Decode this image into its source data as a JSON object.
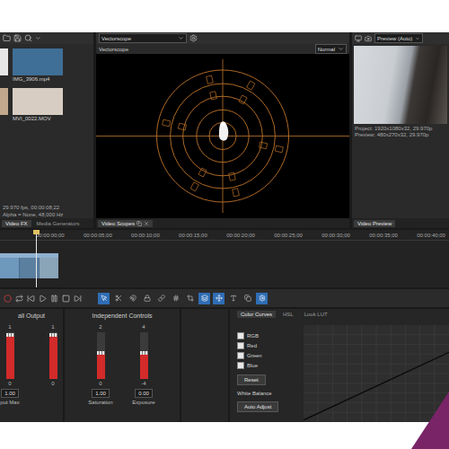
{
  "media": {
    "files": [
      {
        "name": "",
        "color": "#e6e6e6"
      },
      {
        "name": "IMG_3906.mp4",
        "color": "#3f6f97"
      },
      {
        "name": "",
        "color": "#c2a88c"
      },
      {
        "name": "MVI_0022.MOV",
        "color": "#d8cdc2"
      }
    ],
    "info": [
      "29.970 fps, 00:00:08;22",
      "Alpha = None, 48,000 Hz"
    ],
    "tabs": [
      {
        "label": "Video FX",
        "selected": true
      },
      {
        "label": "Media Generators",
        "selected": false
      }
    ]
  },
  "scope": {
    "type": "Vectorscope",
    "title": "Vectorscope",
    "mode": "Normal",
    "tab": "Video Scopes"
  },
  "preview": {
    "quality": "Preview (Auto)",
    "project": "Project: 1920x1080x32, 29.970p",
    "preview": "Preview: 480x270x32, 29.970p",
    "tab": "Video Preview"
  },
  "timeline": {
    "ruler": [
      "00:00:00;00",
      "00:00:05;00",
      "00:00:10;00",
      "00:00:15;00",
      "00:00:20;00",
      "00:00:25;00",
      "00:00:30;00",
      "00:00:35;00",
      "00:00:40;00"
    ],
    "playhead": {
      "level": 0.08
    },
    "clip": {
      "level": 0.13
    }
  },
  "transport": {
    "tools": [
      {
        "selected": true
      },
      {
        "selected": false
      },
      {
        "selected": false
      },
      {
        "selected": false
      },
      {
        "selected": false
      },
      {
        "selected": false
      },
      {
        "selected": false
      },
      {
        "selected": true
      },
      {
        "selected": true
      },
      {
        "selected": false
      },
      {
        "selected": false
      },
      {
        "selected": true
      }
    ]
  },
  "grading": {
    "output": {
      "title": "all Output",
      "sliders": [
        {
          "max": "1",
          "min": "0",
          "level": 0.95,
          "reading": "1.00",
          "name": "put Max"
        },
        {
          "max": "1",
          "min": "0",
          "level": 0.95,
          "reading": "",
          "name": ""
        }
      ]
    },
    "independent": {
      "title": "Independent Controls",
      "sliders": [
        {
          "max": "2",
          "min": "0",
          "level": 0.55,
          "reading": "1.00",
          "name": "Saturation"
        },
        {
          "max": "4",
          "min": "-4",
          "level": 0.55,
          "reading": "0.00",
          "name": "Exposure"
        }
      ]
    },
    "tabs": [
      {
        "label": "Color Curves",
        "selected": true
      },
      {
        "label": "HSL",
        "selected": false
      },
      {
        "label": "Look LUT",
        "selected": false
      }
    ],
    "channels": [
      {
        "label": "RGB",
        "checked": false
      },
      {
        "label": "Red",
        "checked": false
      },
      {
        "label": "Green",
        "checked": false
      },
      {
        "label": "Blue",
        "checked": false
      }
    ],
    "buttons": {
      "reset": "Reset",
      "white_balance": "White Balance",
      "auto_adjust": "Auto Adjust"
    },
    "curve": {
      "points": [
        [
          0,
          0.02
        ],
        [
          1,
          0.72
        ]
      ]
    }
  }
}
